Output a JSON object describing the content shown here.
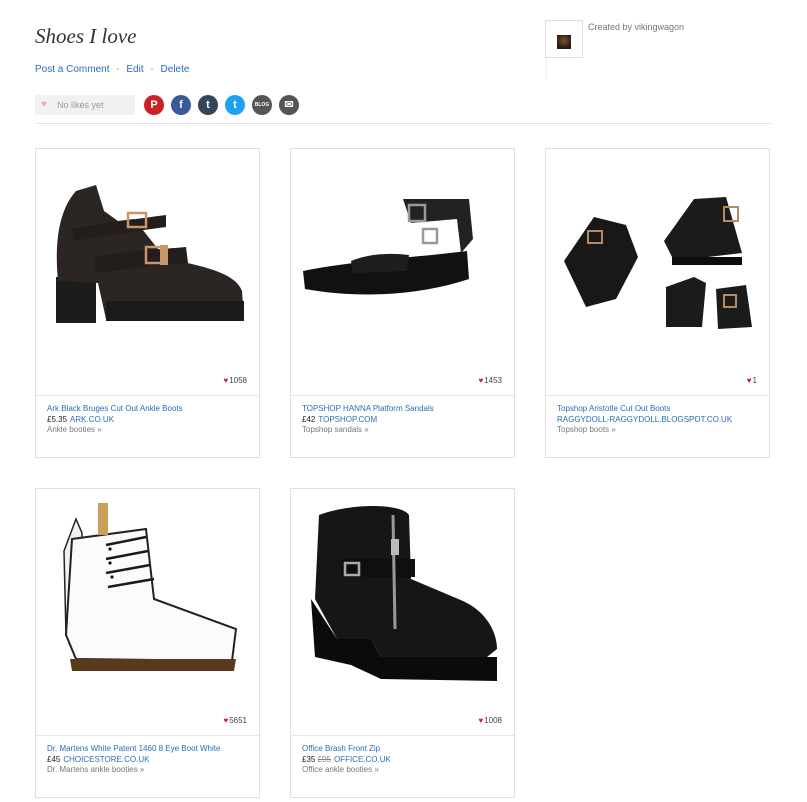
{
  "header": {
    "title": "Shoes I love",
    "actions": [
      "Post a Comment",
      "Edit",
      "Delete"
    ],
    "separator": "-",
    "created_by": "Created by vikingwagon",
    "likes_text": "No likes yet"
  },
  "share": [
    {
      "name": "pinterest-icon",
      "glyph": "P",
      "color": "#cb2027"
    },
    {
      "name": "facebook-icon",
      "glyph": "f",
      "color": "#3b5998"
    },
    {
      "name": "tumblr-icon",
      "glyph": "t",
      "color": "#35465c"
    },
    {
      "name": "twitter-icon",
      "glyph": "t",
      "color": "#1da1f2"
    },
    {
      "name": "blog-icon",
      "glyph": "BLOG",
      "color": "#555555"
    },
    {
      "name": "email-icon",
      "glyph": "✉",
      "color": "#555555"
    }
  ],
  "products": [
    {
      "name": "Ark Black Bruges Cut Out Ankle Boots",
      "price": "£5.35",
      "old_price": "",
      "store": "ARK.CO.UK",
      "category": "Ankle booties »",
      "likes": "1058"
    },
    {
      "name": "TOPSHOP HANNA Platform Sandals",
      "price": "£42",
      "old_price": "",
      "store": "TOPSHOP.COM",
      "category": "Topshop sandals »",
      "likes": "1453"
    },
    {
      "name": "Topshop Aristotle Cut Out Boots",
      "price": "",
      "old_price": "",
      "store": "RAGGYDOLL-RAGGYDOLL.BLOGSPOT.CO.UK",
      "category": "Topshop boots »",
      "likes": "1"
    },
    {
      "name": "Dr. Martens White Patent 1460 8 Eye Boot White",
      "price": "£45",
      "old_price": "",
      "store": "CHOICESTORE.CO.UK",
      "category": "Dr. Martens ankle booties »",
      "likes": "5651"
    },
    {
      "name": "Office Brash Front Zip",
      "price": "£35",
      "old_price": "£95",
      "store": "OFFICE.CO.UK",
      "category": "Office ankle booties »",
      "likes": "1008"
    }
  ]
}
